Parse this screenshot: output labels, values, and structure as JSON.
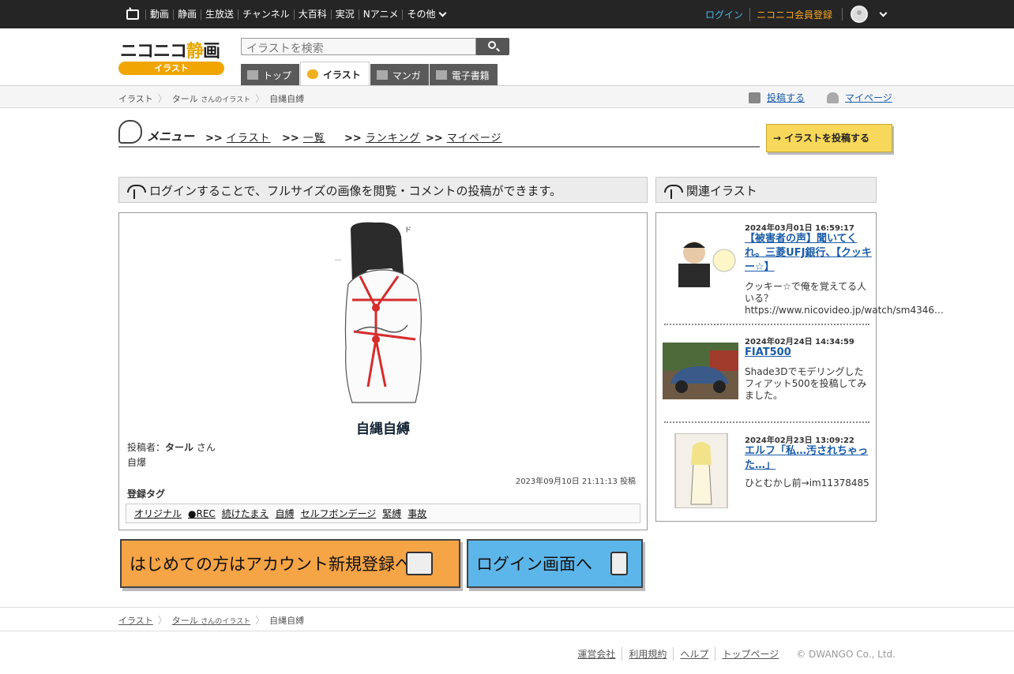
{
  "topnav": {
    "items": [
      "動画",
      "静画",
      "生放送",
      "チャンネル",
      "大百科",
      "実況",
      "Nアニメ",
      "その他"
    ],
    "login": "ログイン",
    "register": "ニコニコ会員登録"
  },
  "header": {
    "logo_text_a": "ニコニコ",
    "logo_text_b": "静",
    "logo_text_c": "画",
    "logo_sub": "イラスト",
    "search_placeholder": "イラストを検索",
    "tabs": [
      "トップ",
      "イラスト",
      "マンガ",
      "電子書籍"
    ],
    "active_tab": "イラスト"
  },
  "breadcrumb": {
    "root": "イラスト",
    "user": "タール",
    "user_suffix": "さんのイラスト",
    "current": "自縄自縛"
  },
  "actions": {
    "post": "投稿する",
    "mypage": "マイページ"
  },
  "menu": {
    "label": "メニュー",
    "links": [
      "イラスト",
      "一覧",
      "ランキング",
      "マイページ"
    ],
    "post_button": "イラストを投稿する"
  },
  "login_notice": "ログインすることで、フルサイズの画像を閲覧・コメントの投稿ができます。",
  "related_header": "関連イラスト",
  "illust": {
    "title": "自縄自縛",
    "poster_label": "投稿者：",
    "poster": "タール",
    "poster_suffix": "さん",
    "description": "自爆",
    "posted_at": "2023年09月10日 21:11:13 投稿",
    "tags_label": "登録タグ",
    "tags": [
      "オリジナル",
      "●REC",
      "続けたまえ",
      "自縛",
      "セルフボンデージ",
      "緊縛",
      "事故"
    ]
  },
  "related": [
    {
      "date": "2024年03月01日 16:59:17",
      "title": "【被害者の声】聞いてくれ。三菱UFJ銀行、【クッキー☆】",
      "text": "クッキー☆で俺を覚えてる人いる？ https://www.nicovideo.jp/watch/sm4346…"
    },
    {
      "date": "2024年02月24日 14:34:59",
      "title": "FIAT500",
      "text": "Shade3Dでモデリングしたフィアット500を投稿してみました。"
    },
    {
      "date": "2024年02月23日 13:09:22",
      "title": "エルフ「私…汚されちゃった…」",
      "text": "ひとむかし前→im11378485"
    }
  ],
  "banners": {
    "signup": "はじめての方はアカウント新規登録へ",
    "login": "ログイン画面へ"
  },
  "footer": {
    "links": [
      "運営会社",
      "利用規約",
      "ヘルプ",
      "トップページ"
    ],
    "copyright": "© DWANGO Co., Ltd."
  },
  "colors": {
    "topbar": "#252525",
    "accent": "#f0a500",
    "link": "#1a5ca8",
    "login": "#4ab6e4",
    "register": "#f6a622"
  }
}
